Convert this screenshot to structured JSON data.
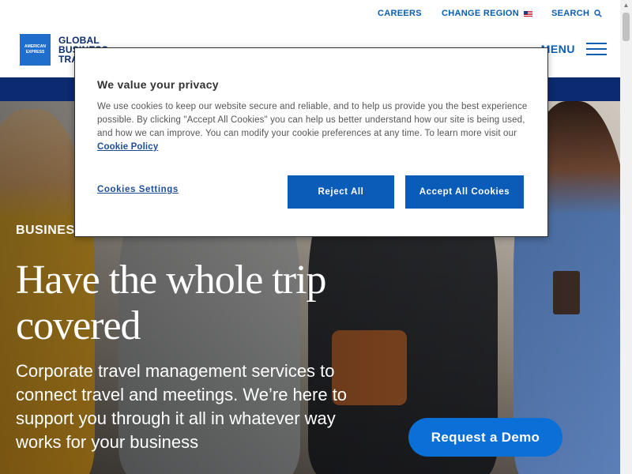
{
  "utility": {
    "careers": "CAREERS",
    "change_region": "CHANGE REGION",
    "search": "SEARCH"
  },
  "header": {
    "logo_box": [
      "AMERICAN",
      "EXPRESS"
    ],
    "logo_text": [
      "GLOBAL",
      "BUSINESS",
      "TRAVEL"
    ],
    "menu": "MENU"
  },
  "hero": {
    "eyebrow": "BUSINESS",
    "headline": "Have the whole trip covered",
    "subhead": "Corporate travel management services to connect travel and meetings. We’re here to support you through it all in whatever way works for your business",
    "cta": "Request a Demo"
  },
  "cookie_modal": {
    "title": "We value your privacy",
    "body": "We use cookies to keep our website secure and reliable, and to help us provide you the best experience possible. By clicking \"Accept All Cookies\" you can help us better understand how our site is being used, and how we can improve. You can modify your cookie preferences at any time. To learn more visit our",
    "policy_link": "Cookie Policy",
    "settings": "Cookies Settings",
    "reject": "Reject All",
    "accept": "Accept All Cookies"
  },
  "colors": {
    "brand_blue": "#0a5eb0",
    "nav_band": "#0b2a6f",
    "button_blue": "#0a5cb8",
    "cta_blue": "#0a6fd6"
  },
  "icons": [
    "search-icon",
    "us-flag-icon",
    "hamburger-menu-icon"
  ]
}
